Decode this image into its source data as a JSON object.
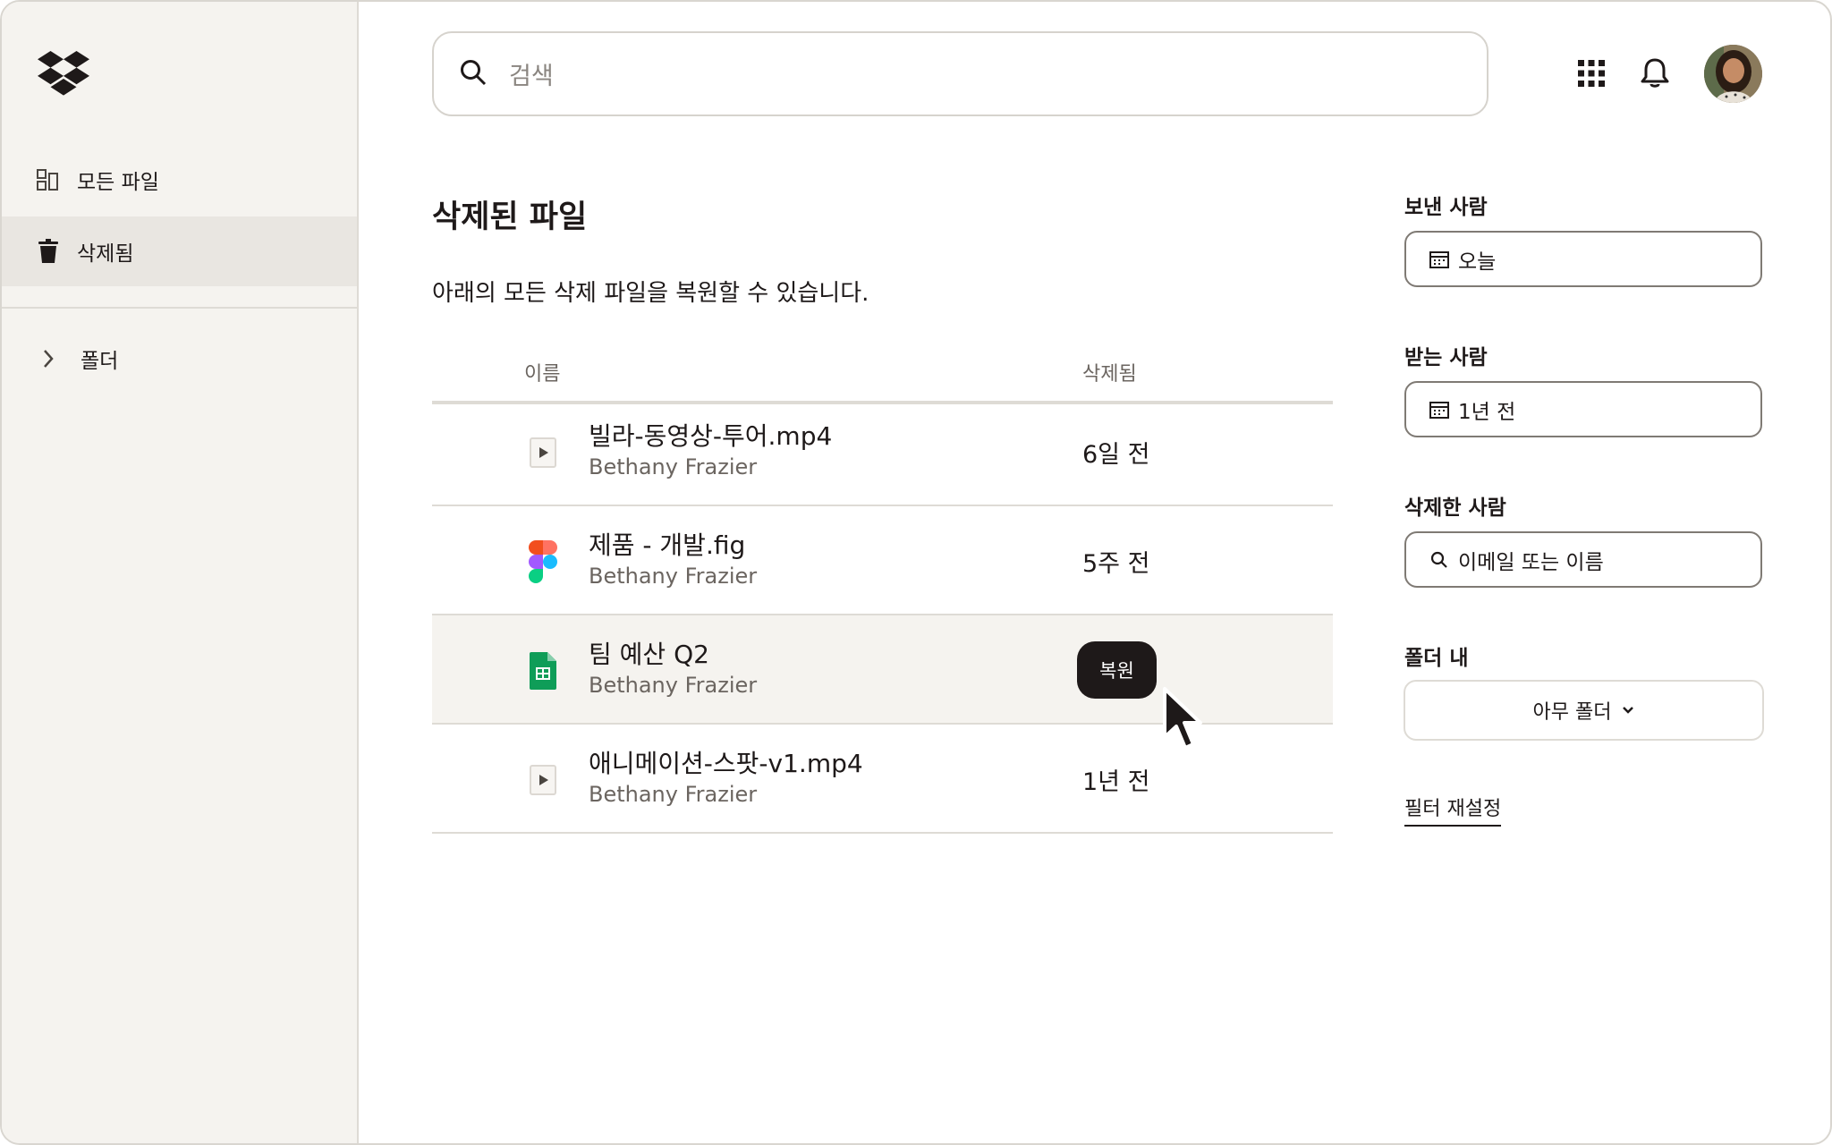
{
  "sidebar": {
    "items": [
      {
        "label": "모든 파일",
        "icon": "grid-files-icon"
      },
      {
        "label": "삭제됨",
        "icon": "trash-icon"
      },
      {
        "label": "폴더",
        "icon": "chevron-right-icon"
      }
    ]
  },
  "header": {
    "search_placeholder": "검색"
  },
  "main": {
    "title": "삭제된 파일",
    "description": "아래의 모든 삭제 파일을 복원할 수 있습니다.",
    "columns": {
      "name": "이름",
      "deleted": "삭제됨"
    },
    "files": [
      {
        "name": "빌라-동영상-투어.mp4",
        "owner": "Bethany Frazier",
        "deleted": "6일 전",
        "icon": "video-file-icon"
      },
      {
        "name": "제품 - 개발.fig",
        "owner": "Bethany Frazier",
        "deleted": "5주 전",
        "icon": "figma-file-icon"
      },
      {
        "name": "팀 예산 Q2",
        "owner": "Bethany Frazier",
        "deleted": "",
        "icon": "spreadsheet-file-icon",
        "action": "복원"
      },
      {
        "name": "애니메이션-스팟-v1.mp4",
        "owner": "Bethany Frazier",
        "deleted": "1년 전",
        "icon": "video-file-icon"
      }
    ]
  },
  "filters": {
    "from_label": "보낸 사람",
    "from_value": "오늘",
    "to_label": "받는 사람",
    "to_value": "1년 전",
    "deleted_by_label": "삭제한 사람",
    "deleted_by_placeholder": "이메일 또는 이름",
    "folder_label": "폴더 내",
    "folder_value": "아무 폴더",
    "reset_label": "필터 재설정"
  },
  "colors": {
    "sidebar_bg": "#f5f3ef",
    "active_bg": "#e9e6e1",
    "text": "#1e1919",
    "muted": "#6b6560",
    "button_bg": "#1e1919"
  }
}
